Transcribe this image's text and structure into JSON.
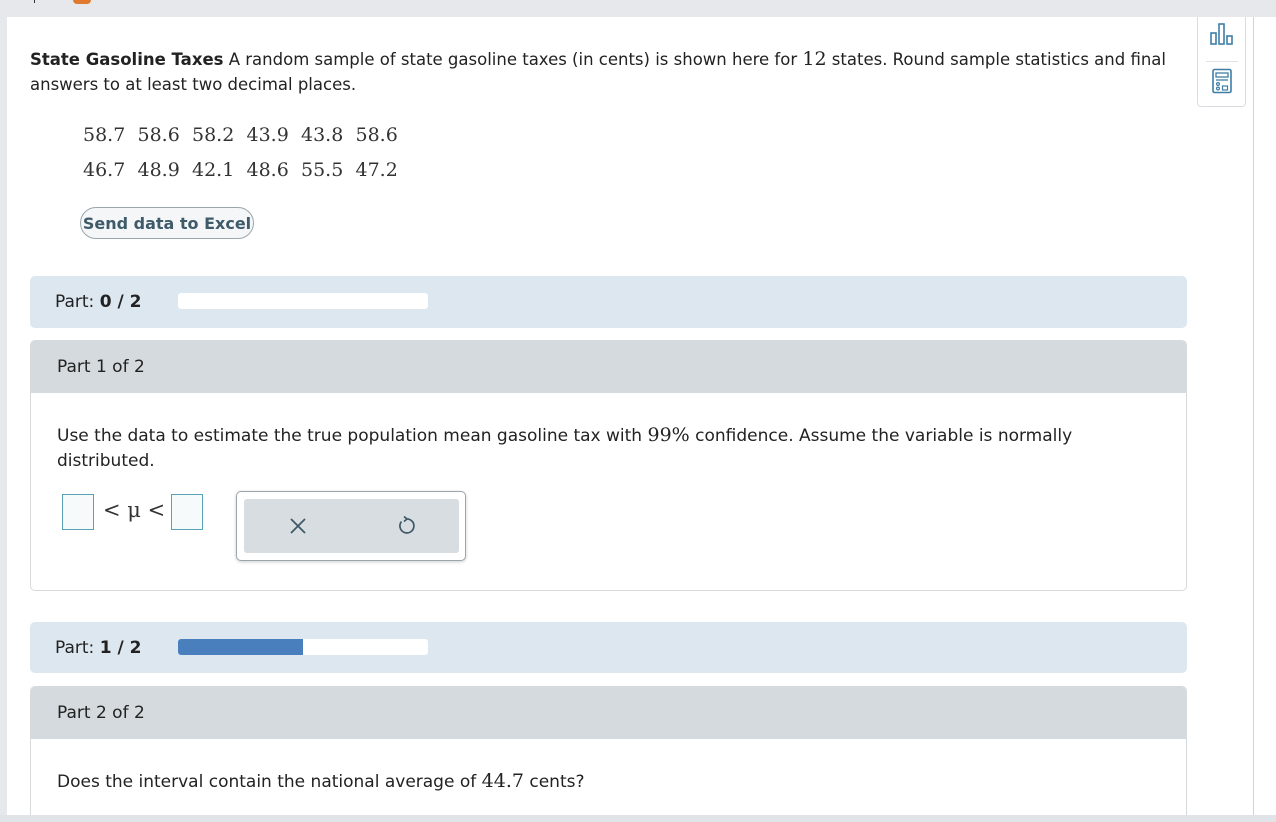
{
  "question": {
    "title": "State Gasoline Taxes",
    "text_before_n": "A random sample of state gasoline taxes (in cents) is shown here for",
    "n": "12",
    "text_after_n": "states. Round sample statistics and final answers to at least two decimal places."
  },
  "data": {
    "rows": [
      [
        "58.7",
        "58.6",
        "58.2",
        "43.9",
        "43.8",
        "58.6"
      ],
      [
        "46.7",
        "48.9",
        "42.1",
        "48.6",
        "55.5",
        "47.2"
      ]
    ]
  },
  "excel_button": "Send data to Excel",
  "progress_bars": [
    {
      "label": "Part:",
      "value": "0 / 2",
      "fraction": 0.0
    },
    {
      "label": "Part:",
      "value": "1 / 2",
      "fraction": 0.5
    }
  ],
  "part1": {
    "header": "Part 1 of 2",
    "text_before": "Use the data to estimate the true population mean gasoline tax with",
    "confidence": "99%",
    "text_after": "confidence. Assume the variable is normally distributed.",
    "inequality": "< μ <",
    "lower_value": "",
    "upper_value": ""
  },
  "part2": {
    "header": "Part 2 of 2",
    "text_before": "Does the interval contain the national average of",
    "value": "44.7",
    "text_after": "cents?"
  },
  "icons": {
    "clear": "close-icon",
    "undo": "undo-icon",
    "chart": "bar-chart-icon",
    "calculator": "calculator-icon"
  },
  "colors": {
    "progress_fill": "#4a7fbd",
    "part_bar_bg": "#dde7f0",
    "part_header_bg": "#d4dadd",
    "input_border": "#5ba1b5"
  }
}
